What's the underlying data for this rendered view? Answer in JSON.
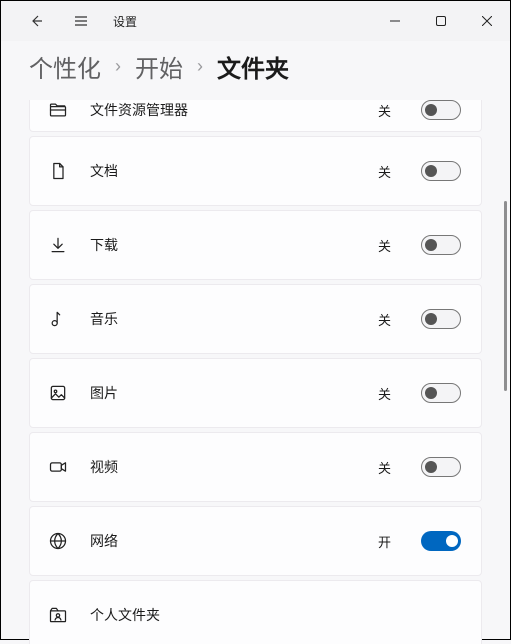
{
  "titlebar": {
    "title": "设置"
  },
  "breadcrumb": {
    "a": "个性化",
    "b": "开始",
    "c": "文件夹",
    "sep": "›"
  },
  "state": {
    "off": "关",
    "on": "开"
  },
  "items": [
    {
      "icon": "file-explorer-icon",
      "label": "文件资源管理器",
      "on": false
    },
    {
      "icon": "document-icon",
      "label": "文档",
      "on": false
    },
    {
      "icon": "download-icon",
      "label": "下载",
      "on": false
    },
    {
      "icon": "music-icon",
      "label": "音乐",
      "on": false
    },
    {
      "icon": "picture-icon",
      "label": "图片",
      "on": false
    },
    {
      "icon": "video-icon",
      "label": "视频",
      "on": false
    },
    {
      "icon": "network-icon",
      "label": "网络",
      "on": true
    },
    {
      "icon": "personal-folder-icon",
      "label": "个人文件夹",
      "on": false
    }
  ]
}
